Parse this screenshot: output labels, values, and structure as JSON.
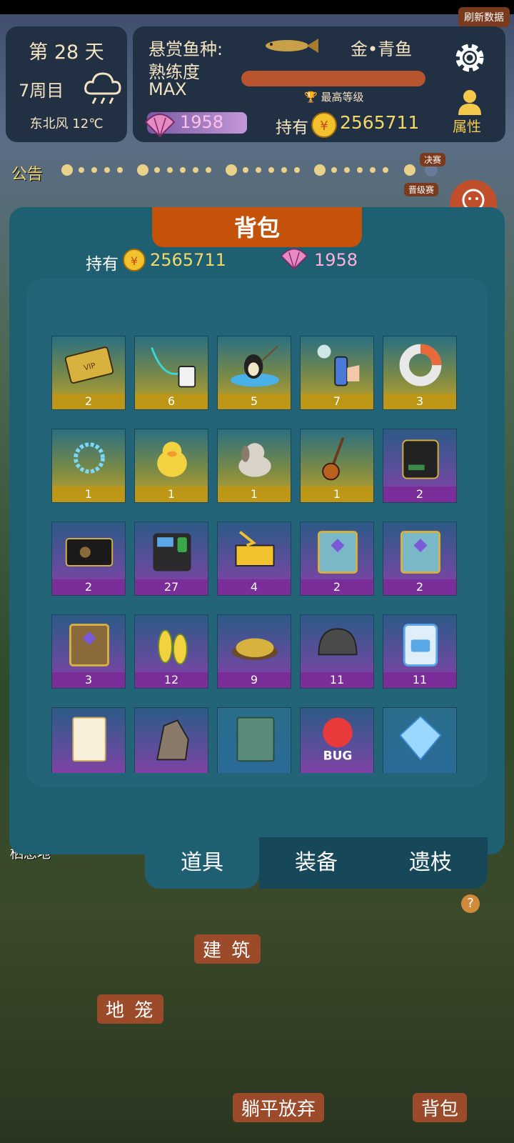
{
  "header": {
    "refresh_button": "刷新数据",
    "day": "第 28 天",
    "round": "7周目",
    "weather_icon": "rain-cloud-icon",
    "wind": "东北风 12℃",
    "bounty_label": "悬赏鱼种:",
    "bounty_fish": "金•青鱼",
    "proficiency_label": "熟练度",
    "proficiency_value": "MAX",
    "proficiency_fill": 1.0,
    "max_level": "最高等级",
    "shells": "1958",
    "hold_label": "持有",
    "coins": "2565711",
    "settings_icon": "gear-icon",
    "attributes_label": "属性"
  },
  "notice_bar": {
    "label": "公告",
    "final_label": "决赛",
    "promotion_label": "晋级赛"
  },
  "backpack": {
    "title": "背包",
    "hold_label": "持有",
    "coins": "2565711",
    "shells": "1958",
    "items": [
      {
        "icon": "vip-card-icon",
        "count": "2",
        "rarity": "gold"
      },
      {
        "icon": "lanyard-tag-icon",
        "count": "6",
        "rarity": "gold"
      },
      {
        "icon": "penguin-fishing-icon",
        "count": "5",
        "rarity": "gold"
      },
      {
        "icon": "spray-can-icon",
        "count": "7",
        "rarity": "gold"
      },
      {
        "icon": "ring-chart-icon",
        "count": "3",
        "rarity": "gold"
      },
      {
        "icon": "glowing-ring-icon",
        "count": "1",
        "rarity": "gold"
      },
      {
        "icon": "yellow-duck-icon",
        "count": "1",
        "rarity": "gold"
      },
      {
        "icon": "plush-dog-icon",
        "count": "1",
        "rarity": "gold"
      },
      {
        "icon": "ukulele-icon",
        "count": "1",
        "rarity": "gold"
      },
      {
        "icon": "black-device-icon",
        "count": "2",
        "rarity": "purple"
      },
      {
        "icon": "black-card-icon",
        "count": "2",
        "rarity": "purple"
      },
      {
        "icon": "fingerprint-machine-icon",
        "count": "27",
        "rarity": "purple"
      },
      {
        "icon": "yellow-chest-icon",
        "count": "4",
        "rarity": "purple"
      },
      {
        "icon": "blue-book-icon",
        "count": "2",
        "rarity": "purple"
      },
      {
        "icon": "blue-book-icon",
        "count": "2",
        "rarity": "purple"
      },
      {
        "icon": "brown-book-icon",
        "count": "3",
        "rarity": "purple"
      },
      {
        "icon": "corn-icon",
        "count": "12",
        "rarity": "purple"
      },
      {
        "icon": "grain-bowl-icon",
        "count": "9",
        "rarity": "purple"
      },
      {
        "icon": "helmet-icon",
        "count": "11",
        "rarity": "purple"
      },
      {
        "icon": "blue-card-icon",
        "count": "11",
        "rarity": "purple"
      },
      {
        "icon": "paper-note-icon",
        "count": "",
        "rarity": "purple"
      },
      {
        "icon": "rock-icon",
        "count": "",
        "rarity": "purple"
      },
      {
        "icon": "green-book-icon",
        "count": "",
        "rarity": "blue"
      },
      {
        "icon": "bug-badge-icon",
        "count": "",
        "rarity": "purple"
      },
      {
        "icon": "crystal-icon",
        "count": "",
        "rarity": "blue"
      }
    ],
    "tabs": [
      "道具",
      "装备",
      "遗枝"
    ],
    "active_tab": 0
  },
  "scene": {
    "habitat": "栖息地",
    "building": "建 筑",
    "cage": "地 笼",
    "give_up": "躺平放弃",
    "backpack": "背包",
    "help": "?"
  }
}
